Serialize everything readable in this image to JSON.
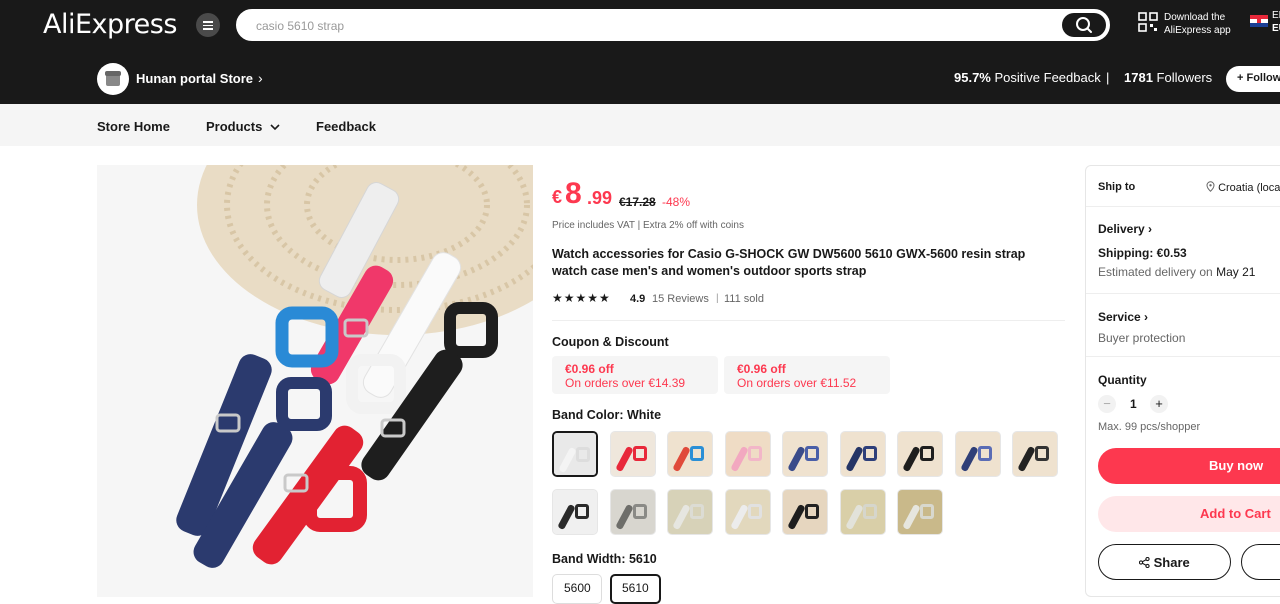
{
  "header": {
    "logo": "AliExpress",
    "search_placeholder": "casio 5610 strap",
    "download_line1": "Download the",
    "download_line2": "AliExpress app",
    "locale_line1": "EN/",
    "locale_line2": "EUR"
  },
  "store": {
    "name": "Hunan portal Store",
    "positive_pct": "95.7%",
    "positive_label": "Positive Feedback",
    "followers_count": "1781",
    "followers_label": "Followers",
    "follow_label": "+ Follow"
  },
  "store_nav": {
    "home": "Store Home",
    "products": "Products",
    "feedback": "Feedback"
  },
  "product": {
    "currency": "€",
    "price_int": "8",
    "price_dec": ".99",
    "price_old": "€17.28",
    "discount": "-48%",
    "vat_note": "Price includes VAT | Extra 2% off with coins",
    "title": "Watch accessories for Casio G-SHOCK GW DW5600 5610 GWX-5600 resin strap watch case men's and women's outdoor sports strap",
    "stars": "★★★★★",
    "rating": "4.9",
    "reviews": "15 Reviews",
    "sold": "111 sold",
    "coupon_heading": "Coupon & Discount",
    "coupons": [
      {
        "amount": "€0.96 off",
        "condition": "On orders over €14.39"
      },
      {
        "amount": "€0.96 off",
        "condition": "On orders over €11.52"
      }
    ],
    "color_heading": "Band Color: White",
    "colors": [
      {
        "strap": "#f4f4f4",
        "case": "#dddddd",
        "bg": "#e9e9e9"
      },
      {
        "strap": "#e8283a",
        "case": "#e8283a",
        "bg": "#efe7dc"
      },
      {
        "strap": "#e04a3a",
        "case": "#2a8fd6",
        "bg": "#efe2cf"
      },
      {
        "strap": "#f2a8c0",
        "case": "#f2b6c8",
        "bg": "#efdcc5"
      },
      {
        "strap": "#3a4b8a",
        "case": "#4a5fa8",
        "bg": "#efe2cf"
      },
      {
        "strap": "#253566",
        "case": "#2e3f7a",
        "bg": "#efe2cf"
      },
      {
        "strap": "#1e1e1e",
        "case": "#1e1e1e",
        "bg": "#efe2cf"
      },
      {
        "strap": "#2f3f78",
        "case": "#5a6cb5",
        "bg": "#efe2cf"
      },
      {
        "strap": "#222222",
        "case": "#333333",
        "bg": "#efe2cf"
      },
      {
        "strap": "#2a2a2a",
        "case": "#2a2a2a",
        "bg": "#f0f0f0"
      },
      {
        "strap": "#6e6e6a",
        "case": "#8a8a86",
        "bg": "#d8d6cf"
      },
      {
        "strap": "#e6e6e0",
        "case": "#dcdcd4",
        "bg": "#d7d2b8"
      },
      {
        "strap": "#ececec",
        "case": "#e1e1e1",
        "bg": "#e2d8bd"
      },
      {
        "strap": "#1e1e1e",
        "case": "#222222",
        "bg": "#e6d6bf"
      },
      {
        "strap": "#e2e2da",
        "case": "#d6d6cc",
        "bg": "#d9cfa8"
      },
      {
        "strap": "#e6e6de",
        "case": "#d8d8ce",
        "bg": "#c9b98a"
      }
    ],
    "width_heading": "Band Width: 5610",
    "widths": [
      "5600",
      "5610"
    ]
  },
  "panel": {
    "ship_to_label": "Ship to",
    "ship_to_value": "Croatia (loca",
    "delivery_label": "Delivery",
    "shipping": "Shipping: €0.53",
    "eta_prefix": "Estimated delivery on",
    "eta_date": "May 21",
    "service_label": "Service",
    "protection": "Buyer protection",
    "quantity_label": "Quantity",
    "quantity": "1",
    "max": "Max. 99 pcs/shopper",
    "buy_now": "Buy now",
    "add_to_cart": "Add to Cart",
    "share": "Share"
  },
  "colors": {
    "accent": "#fd384f",
    "header_bg": "#191919",
    "cart_bg": "#ffe7e9"
  }
}
